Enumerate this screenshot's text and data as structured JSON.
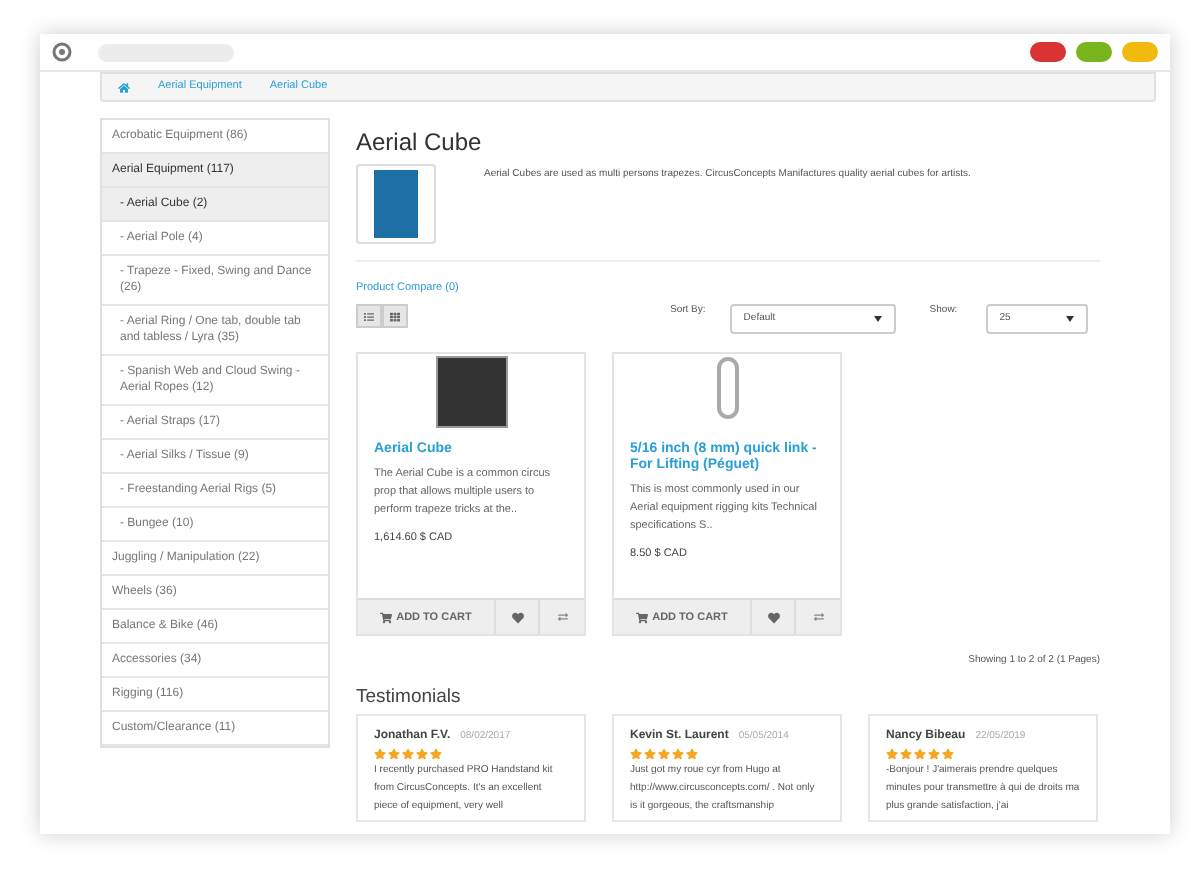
{
  "breadcrumb": [
    "Aerial Equipment",
    "Aerial Cube"
  ],
  "sidebar": {
    "items": [
      {
        "label": "Acrobatic Equipment (86)",
        "selected": false
      },
      {
        "label": "Aerial Equipment (117)",
        "selected": true,
        "children": [
          {
            "label": "- Aerial Cube (2)",
            "selected": true
          },
          {
            "label": "- Aerial Pole (4)",
            "selected": false
          },
          {
            "label": "- Trapeze - Fixed, Swing and Dance (26)",
            "selected": false
          },
          {
            "label": "- Aerial Ring / One tab, double tab and tabless / Lyra (35)",
            "selected": false
          },
          {
            "label": "- Spanish Web and Cloud Swing - Aerial Ropes (12)",
            "selected": false
          },
          {
            "label": "- Aerial Straps (17)",
            "selected": false
          },
          {
            "label": "- Aerial Silks / Tissue (9)",
            "selected": false
          },
          {
            "label": "- Freestanding Aerial Rigs (5)",
            "selected": false
          },
          {
            "label": "- Bungee (10)",
            "selected": false
          }
        ]
      },
      {
        "label": "Juggling / Manipulation (22)",
        "selected": false
      },
      {
        "label": "Wheels (36)",
        "selected": false
      },
      {
        "label": "Balance & Bike (46)",
        "selected": false
      },
      {
        "label": "Accessories (34)",
        "selected": false
      },
      {
        "label": "Rigging (116)",
        "selected": false
      },
      {
        "label": "Custom/Clearance (11)",
        "selected": false
      }
    ]
  },
  "category": {
    "title": "Aerial Cube",
    "description": "Aerial Cubes are used as multi persons trapezes. CircusConcepts Manifactures quality aerial cubes for artists."
  },
  "product_compare": "Product Compare (0)",
  "sort": {
    "label": "Sort By:",
    "value": "Default"
  },
  "show": {
    "label": "Show:",
    "value": "25"
  },
  "products": [
    {
      "kind": "cube",
      "name": "Aerial Cube",
      "description": "The Aerial Cube is a common circus prop that allows multiple users to perform trapeze tricks at the..",
      "price": "1,614.60 $ CAD",
      "cart": "ADD TO CART"
    },
    {
      "kind": "link",
      "name": "5/16 inch (8 mm) quick link - For Lifting (Péguet)",
      "description": "This is most commonly used in our Aerial equipment rigging kits Technical specifications S..",
      "price": "8.50 $ CAD",
      "cart": "ADD TO CART"
    }
  ],
  "pagination": "Showing 1 to 2 of 2 (1 Pages)",
  "testimonials": {
    "title": "Testimonials",
    "items": [
      {
        "name": "Jonathan F.V.",
        "date": "08/02/2017",
        "stars": 5,
        "text": "I recently purchased PRO Handstand kit from CircusConcepts. It's an excellent piece of equipment, very well"
      },
      {
        "name": "Kevin St. Laurent",
        "date": "05/05/2014",
        "stars": 5,
        "text": "Just got my roue cyr from Hugo at http://www.circusconcepts.com/ . Not only is it gorgeous, the craftsmanship"
      },
      {
        "name": "Nancy Bibeau",
        "date": "22/05/2019",
        "stars": 5,
        "text": "-Bonjour ! J'aimerais prendre quelques minutes pour transmettre à qui de droits ma plus grande satisfaction, j'ai"
      }
    ]
  }
}
